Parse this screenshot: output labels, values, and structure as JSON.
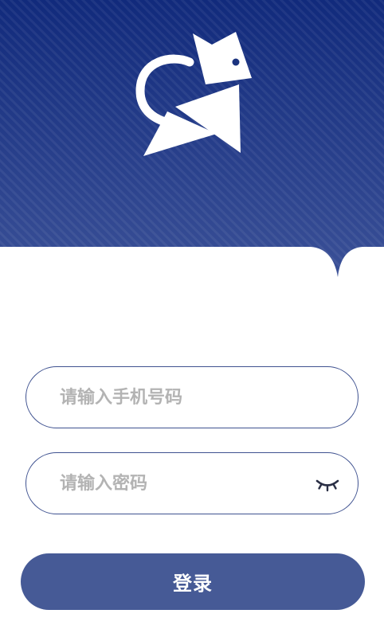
{
  "colors": {
    "header_top": "#102a7a",
    "header_bottom": "#3b5196",
    "accent": "#465a96",
    "input_border": "#3f5290",
    "placeholder": "#b3b3b3"
  },
  "header": {
    "logo_icon": "cat-logo-icon"
  },
  "form": {
    "phone": {
      "placeholder": "请输入手机号码",
      "value": ""
    },
    "password": {
      "placeholder": "请输入密码",
      "value": "",
      "toggle_icon": "eye-closed-icon"
    },
    "login_label": "登录"
  }
}
